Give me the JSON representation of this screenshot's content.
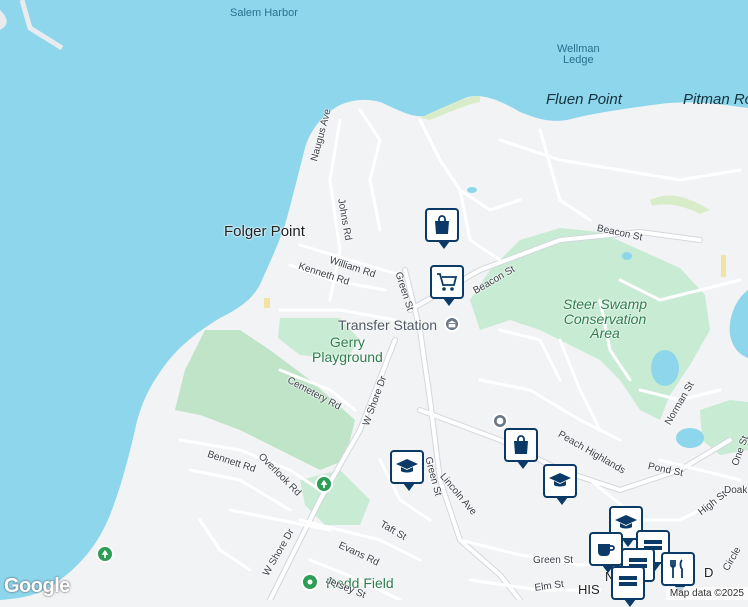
{
  "map": {
    "colors": {
      "water": "#8dd6ec",
      "land": "#f2f3f5",
      "park": "#c8ebd3",
      "cemetery": "#bfe4c8",
      "road": "#ffffff",
      "road_outline": "#d3d8de",
      "marker": "#0b3a66"
    },
    "labels": {
      "salem_harbor": "Salem Harbor",
      "wellman_ledge": "Wellman\nLedge",
      "fluen_point": "Fluen Point",
      "pitman_road": "Pitman Ro",
      "folger_point": "Folger Point",
      "transfer_station": "Transfer Station",
      "gerry_playground": "Gerry\nPlayground",
      "steer_swamp": "Steer Swamp\nConservation\nArea",
      "redd_field": "Redd Field",
      "hist_district": "HIS",
      "n_partial": "N",
      "d_partial": "D"
    },
    "streets": {
      "naugus_ave": "Naugus Ave",
      "johns_rd": "Johns Rd",
      "william_rd": "William Rd",
      "kenneth_rd": "Kenneth Rd",
      "green_st_north": "Green St",
      "beacon_st_mid": "Beacon St",
      "beacon_st_east": "Beacon St",
      "cemetery_rd": "Cemetery Rd",
      "w_shore_dr_north": "W Shore Dr",
      "w_shore_dr_south": "W Shore Dr",
      "bennett_rd": "Bennett Rd",
      "overlook_rd": "Overlook Rd",
      "green_st_south": "Green St",
      "lincoln_ave": "Lincoln Ave",
      "peach_highlands": "Peach Highlands",
      "norman_st": "Norman St",
      "pond_st": "Pond St",
      "high_st": "High St",
      "taft_st": "Taft St",
      "evans_rd": "Evans Rd",
      "jersey_st": "Jersey St",
      "green_st_east": "Green St",
      "elm_st": "Elm St",
      "circle": "Circle",
      "one_st": "One St",
      "doak": "Doak"
    },
    "markers": [
      {
        "name": "shopping-bag-marker",
        "icon": "shopping-bag-icon"
      },
      {
        "name": "shopping-cart-marker",
        "icon": "shopping-cart-icon"
      },
      {
        "name": "school-marker",
        "icon": "graduation-cap-icon"
      },
      {
        "name": "shopping-bag-marker-2",
        "icon": "shopping-bag-icon"
      },
      {
        "name": "school-marker-2",
        "icon": "graduation-cap-icon"
      },
      {
        "name": "school-marker-3",
        "icon": "graduation-cap-icon"
      },
      {
        "name": "coffee-marker",
        "icon": "coffee-cup-icon"
      },
      {
        "name": "restaurant-marker",
        "icon": "fork-knife-icon"
      }
    ],
    "branding": {
      "logo": "Google",
      "attribution": "Map data ©2025"
    }
  }
}
